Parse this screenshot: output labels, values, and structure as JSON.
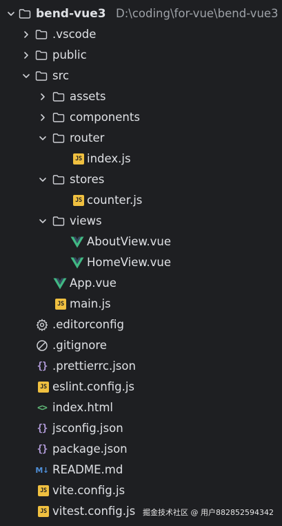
{
  "project": {
    "name": "bend-vue3",
    "path": "D:\\coding\\for-vue\\bend-vue3"
  },
  "tree": {
    "vscode": ".vscode",
    "public": "public",
    "src": "src",
    "assets": "assets",
    "components": "components",
    "router": "router",
    "router_index": "index.js",
    "stores": "stores",
    "counter": "counter.js",
    "views": "views",
    "about_view": "AboutView.vue",
    "home_view": "HomeView.vue",
    "app_vue": "App.vue",
    "main_js": "main.js",
    "editorconfig": ".editorconfig",
    "gitignore": ".gitignore",
    "prettierrc": ".prettierrc.json",
    "eslint": "eslint.config.js",
    "index_html": "index.html",
    "jsconfig": "jsconfig.json",
    "package_json": "package.json",
    "readme": "README.md",
    "vite_config": "vite.config.js",
    "vitest_config": "vitest.config.js"
  },
  "icons": {
    "js_badge": "JS",
    "json_braces": "{}",
    "html_brackets": "<>",
    "md_badge": "M↓"
  },
  "colors": {
    "background": "#1e1f22",
    "text": "#dfe1e5",
    "muted": "#9ea2a8",
    "js": "#f0c040",
    "vue": "#41b883",
    "json": "#b39ddb",
    "html": "#5fb878",
    "md": "#4f8fd8"
  },
  "watermark": "掘金技术社区 @ 用户882852594342"
}
